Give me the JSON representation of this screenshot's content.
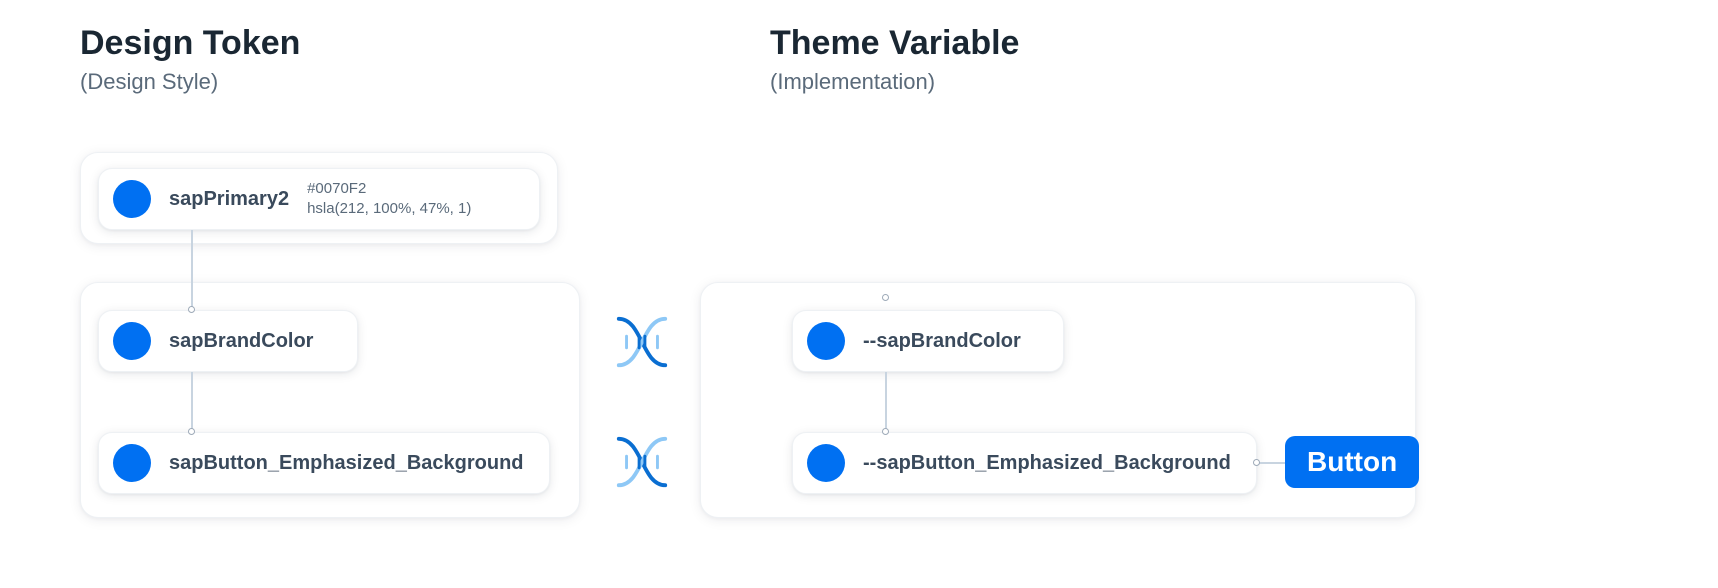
{
  "colors": {
    "brand": "#0070F2"
  },
  "left": {
    "title": "Design Token",
    "subtitle": "(Design Style)",
    "tokens": {
      "primary": {
        "name": "sapPrimary2",
        "hex": "#0070F2",
        "hsla": "hsla(212, 100%, 47%, 1)"
      },
      "brand": {
        "name": "sapBrandColor"
      },
      "button": {
        "name": "sapButton_Emphasized_Background"
      }
    }
  },
  "right": {
    "title": "Theme Variable",
    "subtitle": "(Implementation)",
    "vars": {
      "brand": {
        "name": "--sapBrandColor"
      },
      "button": {
        "name": "--sapButton_Emphasized_Background"
      }
    },
    "button_label": "Button"
  }
}
